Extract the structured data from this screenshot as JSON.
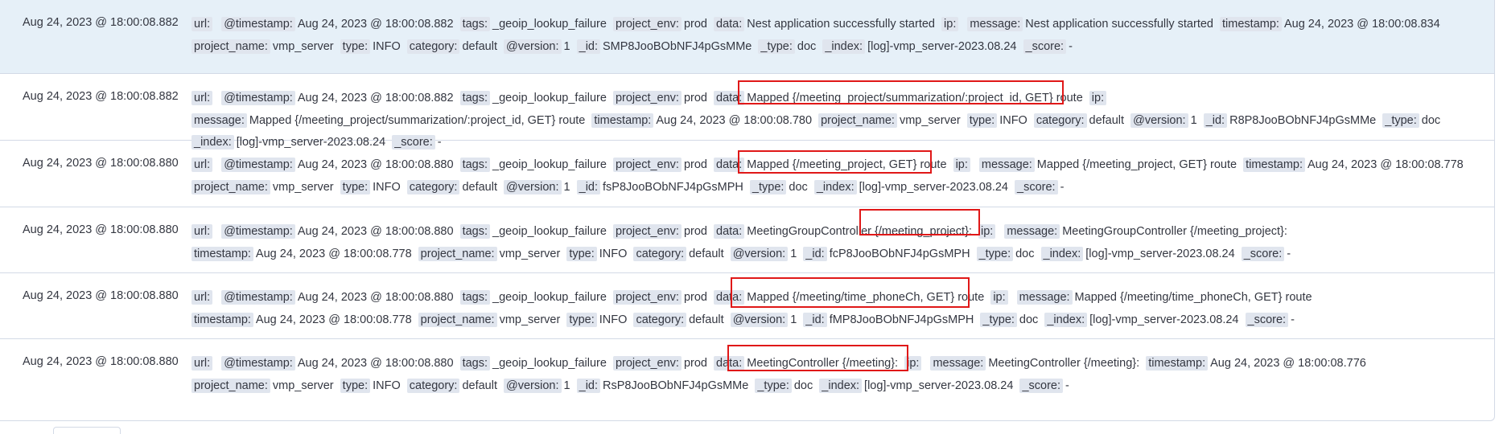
{
  "rows": [
    {
      "timestamp": "Aug 24, 2023 @ 18:00:08.882",
      "fields": [
        [
          "url:",
          ""
        ],
        [
          "@timestamp:",
          "Aug 24, 2023 @ 18:00:08.882"
        ],
        [
          "tags:",
          "_geoip_lookup_failure"
        ],
        [
          "project_env:",
          "prod"
        ],
        [
          "data:",
          "Nest application successfully started"
        ],
        [
          "ip:",
          ""
        ],
        [
          "message:",
          "Nest application successfully started"
        ],
        [
          "timestamp:",
          "Aug 24, 2023 @ 18:00:08.834"
        ],
        [
          "project_name:",
          "vmp_server"
        ],
        [
          "type:",
          "INFO"
        ],
        [
          "category:",
          "default"
        ],
        [
          "@version:",
          "1"
        ],
        [
          "_id:",
          "SMP8JooBObNFJ4pGsMMe"
        ],
        [
          "_type:",
          "doc"
        ],
        [
          "_index:",
          "[log]-vmp_server-2023.08.24"
        ],
        [
          "_score:",
          "-"
        ]
      ]
    },
    {
      "timestamp": "Aug 24, 2023 @ 18:00:08.882",
      "fields": [
        [
          "url:",
          ""
        ],
        [
          "@timestamp:",
          "Aug 24, 2023 @ 18:00:08.882"
        ],
        [
          "tags:",
          "_geoip_lookup_failure"
        ],
        [
          "project_env:",
          "prod"
        ],
        [
          "data:",
          "Mapped {/meeting_project/summarization/:project_id, GET} route"
        ],
        [
          "ip:",
          ""
        ],
        [
          "message:",
          "Mapped {/meeting_project/summarization/:project_id, GET} route"
        ],
        [
          "timestamp:",
          "Aug 24, 2023 @ 18:00:08.780"
        ],
        [
          "project_name:",
          "vmp_server"
        ],
        [
          "type:",
          "INFO"
        ],
        [
          "category:",
          "default"
        ],
        [
          "@version:",
          "1"
        ],
        [
          "_id:",
          "R8P8JooBObNFJ4pGsMMe"
        ],
        [
          "_type:",
          "doc"
        ],
        [
          "_index:",
          "[log]-vmp_server-2023.08.24"
        ],
        [
          "_score:",
          "-"
        ]
      ]
    },
    {
      "timestamp": "Aug 24, 2023 @ 18:00:08.880",
      "fields": [
        [
          "url:",
          ""
        ],
        [
          "@timestamp:",
          "Aug 24, 2023 @ 18:00:08.880"
        ],
        [
          "tags:",
          "_geoip_lookup_failure"
        ],
        [
          "project_env:",
          "prod"
        ],
        [
          "data:",
          "Mapped {/meeting_project, GET} route"
        ],
        [
          "ip:",
          ""
        ],
        [
          "message:",
          "Mapped {/meeting_project, GET} route"
        ],
        [
          "timestamp:",
          "Aug 24, 2023 @ 18:00:08.778"
        ],
        [
          "project_name:",
          "vmp_server"
        ],
        [
          "type:",
          "INFO"
        ],
        [
          "category:",
          "default"
        ],
        [
          "@version:",
          "1"
        ],
        [
          "_id:",
          "fsP8JooBObNFJ4pGsMPH"
        ],
        [
          "_type:",
          "doc"
        ],
        [
          "_index:",
          "[log]-vmp_server-2023.08.24"
        ],
        [
          "_score:",
          "-"
        ]
      ]
    },
    {
      "timestamp": "Aug 24, 2023 @ 18:00:08.880",
      "fields": [
        [
          "url:",
          ""
        ],
        [
          "@timestamp:",
          "Aug 24, 2023 @ 18:00:08.880"
        ],
        [
          "tags:",
          "_geoip_lookup_failure"
        ],
        [
          "project_env:",
          "prod"
        ],
        [
          "data:",
          "MeetingGroupController {/meeting_project}:"
        ],
        [
          "ip:",
          ""
        ],
        [
          "message:",
          "MeetingGroupController {/meeting_project}:"
        ],
        [
          "timestamp:",
          "Aug 24, 2023 @ 18:00:08.778"
        ],
        [
          "project_name:",
          "vmp_server"
        ],
        [
          "type:",
          "INFO"
        ],
        [
          "category:",
          "default"
        ],
        [
          "@version:",
          "1"
        ],
        [
          "_id:",
          "fcP8JooBObNFJ4pGsMPH"
        ],
        [
          "_type:",
          "doc"
        ],
        [
          "_index:",
          "[log]-vmp_server-2023.08.24"
        ],
        [
          "_score:",
          "-"
        ]
      ]
    },
    {
      "timestamp": "Aug 24, 2023 @ 18:00:08.880",
      "fields": [
        [
          "url:",
          ""
        ],
        [
          "@timestamp:",
          "Aug 24, 2023 @ 18:00:08.880"
        ],
        [
          "tags:",
          "_geoip_lookup_failure"
        ],
        [
          "project_env:",
          "prod"
        ],
        [
          "data:",
          "Mapped {/meeting/time_phoneCh, GET} route"
        ],
        [
          "ip:",
          ""
        ],
        [
          "message:",
          "Mapped {/meeting/time_phoneCh, GET} route"
        ],
        [
          "timestamp:",
          "Aug 24, 2023 @ 18:00:08.778"
        ],
        [
          "project_name:",
          "vmp_server"
        ],
        [
          "type:",
          "INFO"
        ],
        [
          "category:",
          "default"
        ],
        [
          "@version:",
          "1"
        ],
        [
          "_id:",
          "fMP8JooBObNFJ4pGsMPH"
        ],
        [
          "_type:",
          "doc"
        ],
        [
          "_index:",
          "[log]-vmp_server-2023.08.24"
        ],
        [
          "_score:",
          "-"
        ]
      ]
    },
    {
      "timestamp": "Aug 24, 2023 @ 18:00:08.880",
      "fields": [
        [
          "url:",
          ""
        ],
        [
          "@timestamp:",
          "Aug 24, 2023 @ 18:00:08.880"
        ],
        [
          "tags:",
          "_geoip_lookup_failure"
        ],
        [
          "project_env:",
          "prod"
        ],
        [
          "data:",
          "MeetingController {/meeting}:"
        ],
        [
          "ip:",
          ""
        ],
        [
          "message:",
          "MeetingController {/meeting}:"
        ],
        [
          "timestamp:",
          "Aug 24, 2023 @ 18:00:08.776"
        ],
        [
          "project_name:",
          "vmp_server"
        ],
        [
          "type:",
          "INFO"
        ],
        [
          "category:",
          "default"
        ],
        [
          "@version:",
          "1"
        ],
        [
          "_id:",
          "RsP8JooBObNFJ4pGsMMe"
        ],
        [
          "_type:",
          "doc"
        ],
        [
          "_index:",
          "[log]-vmp_server-2023.08.24"
        ],
        [
          "_score:",
          "-"
        ]
      ]
    }
  ],
  "colors": {
    "highlight_row": "#e6f0f8",
    "key_badge": "#e0e5ee",
    "annotation_box": "#e01818"
  }
}
